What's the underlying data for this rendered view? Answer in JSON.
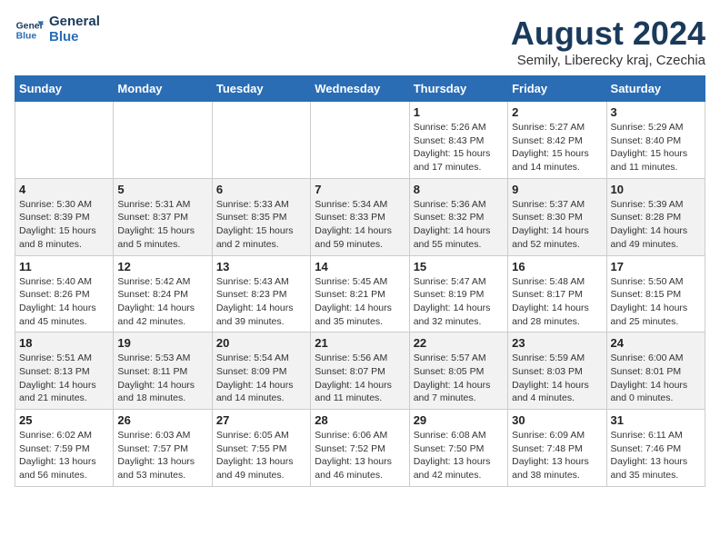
{
  "header": {
    "logo_line1": "General",
    "logo_line2": "Blue",
    "month": "August 2024",
    "location": "Semily, Liberecky kraj, Czechia"
  },
  "weekdays": [
    "Sunday",
    "Monday",
    "Tuesday",
    "Wednesday",
    "Thursday",
    "Friday",
    "Saturday"
  ],
  "weeks": [
    [
      {
        "day": "",
        "info": ""
      },
      {
        "day": "",
        "info": ""
      },
      {
        "day": "",
        "info": ""
      },
      {
        "day": "",
        "info": ""
      },
      {
        "day": "1",
        "info": "Sunrise: 5:26 AM\nSunset: 8:43 PM\nDaylight: 15 hours\nand 17 minutes."
      },
      {
        "day": "2",
        "info": "Sunrise: 5:27 AM\nSunset: 8:42 PM\nDaylight: 15 hours\nand 14 minutes."
      },
      {
        "day": "3",
        "info": "Sunrise: 5:29 AM\nSunset: 8:40 PM\nDaylight: 15 hours\nand 11 minutes."
      }
    ],
    [
      {
        "day": "4",
        "info": "Sunrise: 5:30 AM\nSunset: 8:39 PM\nDaylight: 15 hours\nand 8 minutes."
      },
      {
        "day": "5",
        "info": "Sunrise: 5:31 AM\nSunset: 8:37 PM\nDaylight: 15 hours\nand 5 minutes."
      },
      {
        "day": "6",
        "info": "Sunrise: 5:33 AM\nSunset: 8:35 PM\nDaylight: 15 hours\nand 2 minutes."
      },
      {
        "day": "7",
        "info": "Sunrise: 5:34 AM\nSunset: 8:33 PM\nDaylight: 14 hours\nand 59 minutes."
      },
      {
        "day": "8",
        "info": "Sunrise: 5:36 AM\nSunset: 8:32 PM\nDaylight: 14 hours\nand 55 minutes."
      },
      {
        "day": "9",
        "info": "Sunrise: 5:37 AM\nSunset: 8:30 PM\nDaylight: 14 hours\nand 52 minutes."
      },
      {
        "day": "10",
        "info": "Sunrise: 5:39 AM\nSunset: 8:28 PM\nDaylight: 14 hours\nand 49 minutes."
      }
    ],
    [
      {
        "day": "11",
        "info": "Sunrise: 5:40 AM\nSunset: 8:26 PM\nDaylight: 14 hours\nand 45 minutes."
      },
      {
        "day": "12",
        "info": "Sunrise: 5:42 AM\nSunset: 8:24 PM\nDaylight: 14 hours\nand 42 minutes."
      },
      {
        "day": "13",
        "info": "Sunrise: 5:43 AM\nSunset: 8:23 PM\nDaylight: 14 hours\nand 39 minutes."
      },
      {
        "day": "14",
        "info": "Sunrise: 5:45 AM\nSunset: 8:21 PM\nDaylight: 14 hours\nand 35 minutes."
      },
      {
        "day": "15",
        "info": "Sunrise: 5:47 AM\nSunset: 8:19 PM\nDaylight: 14 hours\nand 32 minutes."
      },
      {
        "day": "16",
        "info": "Sunrise: 5:48 AM\nSunset: 8:17 PM\nDaylight: 14 hours\nand 28 minutes."
      },
      {
        "day": "17",
        "info": "Sunrise: 5:50 AM\nSunset: 8:15 PM\nDaylight: 14 hours\nand 25 minutes."
      }
    ],
    [
      {
        "day": "18",
        "info": "Sunrise: 5:51 AM\nSunset: 8:13 PM\nDaylight: 14 hours\nand 21 minutes."
      },
      {
        "day": "19",
        "info": "Sunrise: 5:53 AM\nSunset: 8:11 PM\nDaylight: 14 hours\nand 18 minutes."
      },
      {
        "day": "20",
        "info": "Sunrise: 5:54 AM\nSunset: 8:09 PM\nDaylight: 14 hours\nand 14 minutes."
      },
      {
        "day": "21",
        "info": "Sunrise: 5:56 AM\nSunset: 8:07 PM\nDaylight: 14 hours\nand 11 minutes."
      },
      {
        "day": "22",
        "info": "Sunrise: 5:57 AM\nSunset: 8:05 PM\nDaylight: 14 hours\nand 7 minutes."
      },
      {
        "day": "23",
        "info": "Sunrise: 5:59 AM\nSunset: 8:03 PM\nDaylight: 14 hours\nand 4 minutes."
      },
      {
        "day": "24",
        "info": "Sunrise: 6:00 AM\nSunset: 8:01 PM\nDaylight: 14 hours\nand 0 minutes."
      }
    ],
    [
      {
        "day": "25",
        "info": "Sunrise: 6:02 AM\nSunset: 7:59 PM\nDaylight: 13 hours\nand 56 minutes."
      },
      {
        "day": "26",
        "info": "Sunrise: 6:03 AM\nSunset: 7:57 PM\nDaylight: 13 hours\nand 53 minutes."
      },
      {
        "day": "27",
        "info": "Sunrise: 6:05 AM\nSunset: 7:55 PM\nDaylight: 13 hours\nand 49 minutes."
      },
      {
        "day": "28",
        "info": "Sunrise: 6:06 AM\nSunset: 7:52 PM\nDaylight: 13 hours\nand 46 minutes."
      },
      {
        "day": "29",
        "info": "Sunrise: 6:08 AM\nSunset: 7:50 PM\nDaylight: 13 hours\nand 42 minutes."
      },
      {
        "day": "30",
        "info": "Sunrise: 6:09 AM\nSunset: 7:48 PM\nDaylight: 13 hours\nand 38 minutes."
      },
      {
        "day": "31",
        "info": "Sunrise: 6:11 AM\nSunset: 7:46 PM\nDaylight: 13 hours\nand 35 minutes."
      }
    ]
  ]
}
